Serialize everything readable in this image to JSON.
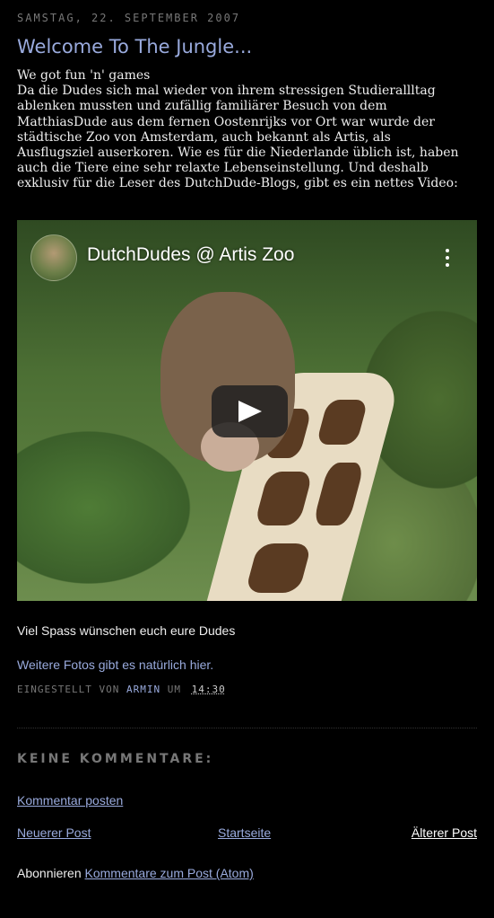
{
  "post": {
    "date": "Samstag, 22. September 2007",
    "title": "Welcome To The Jungle...",
    "lines": [
      "We got fun 'n' games",
      "Da die Dudes sich mal wieder von ihrem stressigen Studierallltag",
      "ablenken mussten und zufällig familiärer Besuch von dem",
      "MatthiasDude aus dem fernen Oostenrijks vor Ort war wurde der",
      "städtische Zoo von Amsterdam, auch bekannt als Artis, als",
      "Ausflugsziel auserkoren. Wie es für die Niederlande üblich ist, haben",
      "auch die Tiere eine sehr relaxte Lebenseinstellung. Und deshalb",
      "exklusiv für die Leser des DutchDude-Blogs, gibt es ein nettes Video:"
    ],
    "video": {
      "title": "DutchDudes @ Artis Zoo",
      "play_icon": "play-icon",
      "menu_icon": "more-vert-icon"
    },
    "after_video": "Viel Spass wünschen euch eure Dudes",
    "more_photos_link": "Weitere Fotos gibt es natürlich hier.",
    "footer": {
      "posted_by": "Eingestellt von",
      "author": "Armin",
      "at": "um",
      "time": "14:30"
    }
  },
  "comments": {
    "heading": "Keine Kommentare:",
    "post_comment": "Kommentar posten"
  },
  "nav": {
    "newer": "Neuerer Post",
    "home": "Startseite",
    "older": "Älterer Post"
  },
  "subscribe": {
    "label": "Abonnieren",
    "link": "Kommentare zum Post (Atom)"
  },
  "colors": {
    "background": "#000000",
    "link": "#99aadd",
    "text": "#eeeeee",
    "muted": "#777777"
  }
}
